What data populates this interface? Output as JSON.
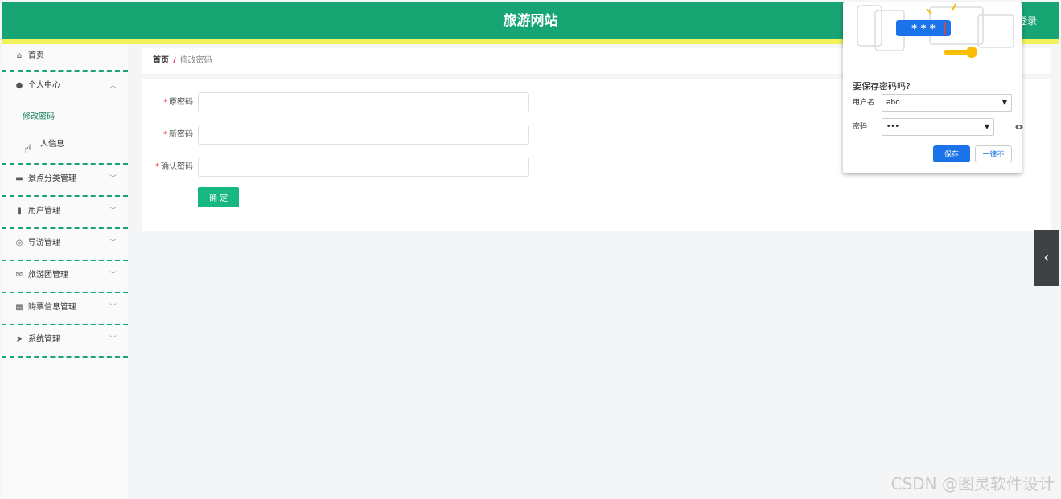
{
  "header": {
    "site_title": "旅游网站",
    "login_label": "登录",
    "bg_color": "#17a574"
  },
  "sidebar": {
    "home": {
      "label": "首页",
      "icon": "home-icon"
    },
    "groups": [
      {
        "label": "个人中心",
        "icon": "user-icon",
        "expanded": true,
        "children": [
          "修改密码",
          "个人信息"
        ]
      },
      {
        "label": "景点分类管理",
        "icon": "monitor-icon"
      },
      {
        "label": "用户管理",
        "icon": "trash-icon"
      },
      {
        "label": "导游管理",
        "icon": "globe-icon"
      },
      {
        "label": "旅游团管理",
        "icon": "mail-icon"
      },
      {
        "label": "购票信息管理",
        "icon": "grid-icon"
      },
      {
        "label": "系统管理",
        "icon": "send-icon"
      }
    ],
    "visible_sub_2_text": "人信息"
  },
  "breadcrumb": {
    "home": "首页",
    "separator": "/",
    "current": "修改密码"
  },
  "form": {
    "required_mark": "*",
    "fields": [
      {
        "label": "原密码",
        "value": ""
      },
      {
        "label": "新密码",
        "value": ""
      },
      {
        "label": "确认密码",
        "value": ""
      }
    ],
    "submit_label": "确 定"
  },
  "password_popup": {
    "title": "要保存密码吗?",
    "username_label": "用户名",
    "username_value": "abo",
    "password_label": "密码",
    "password_value": "•••",
    "save_label": "保存",
    "never_label": "一律不",
    "illustration_text": "* * *",
    "accent_color": "#1a73e8"
  },
  "side_tab": {
    "icon": "chevron-left-icon",
    "glyph": "‹"
  },
  "watermark": "CSDN @图灵软件设计"
}
